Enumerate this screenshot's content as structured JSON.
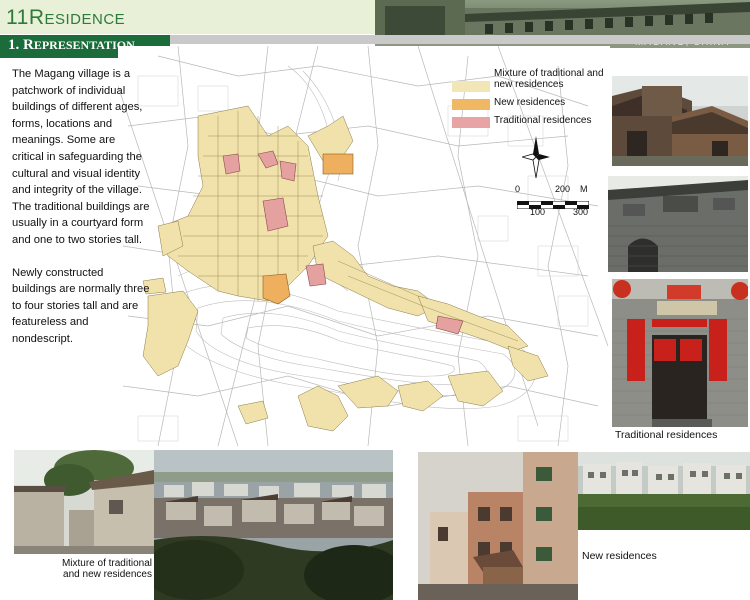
{
  "header": {
    "title_num": "11",
    "title_initial": "R",
    "title_rest": "ESIDENCE",
    "section_prefix": "1. R",
    "section_rest": "EPRESENTATION",
    "place": "MAGANG, CHINA"
  },
  "intro": {
    "p1": "The Magang village is a patchwork of individual buildings of different ages, forms, locations and meanings. Some are critical in safeguarding the cultural and visual identity and integrity of the village. The traditional buildings are usually in a courtyard form and one to two stories tall.",
    "p2": "Newly constructed buildings are normally three to four stories tall and are featureless and nondescript."
  },
  "legend": {
    "items": [
      {
        "label": "Mixture of traditional and new residences",
        "color": "#f3e6b6"
      },
      {
        "label": "New residences",
        "color": "#f0b764"
      },
      {
        "label": "Traditional residences",
        "color": "#e8a4a4"
      }
    ],
    "scale_top": [
      "0",
      "200",
      "M"
    ],
    "scale_bottom": [
      "100",
      "300"
    ]
  },
  "captions": {
    "traditional": "Traditional residences",
    "mixture": "Mixture of traditional and new residences",
    "new": "New residences"
  },
  "colors": {
    "header_green": "#2e7a3a",
    "section_bar": "#1c6b3a",
    "header_bg": "#e8f0d8"
  }
}
